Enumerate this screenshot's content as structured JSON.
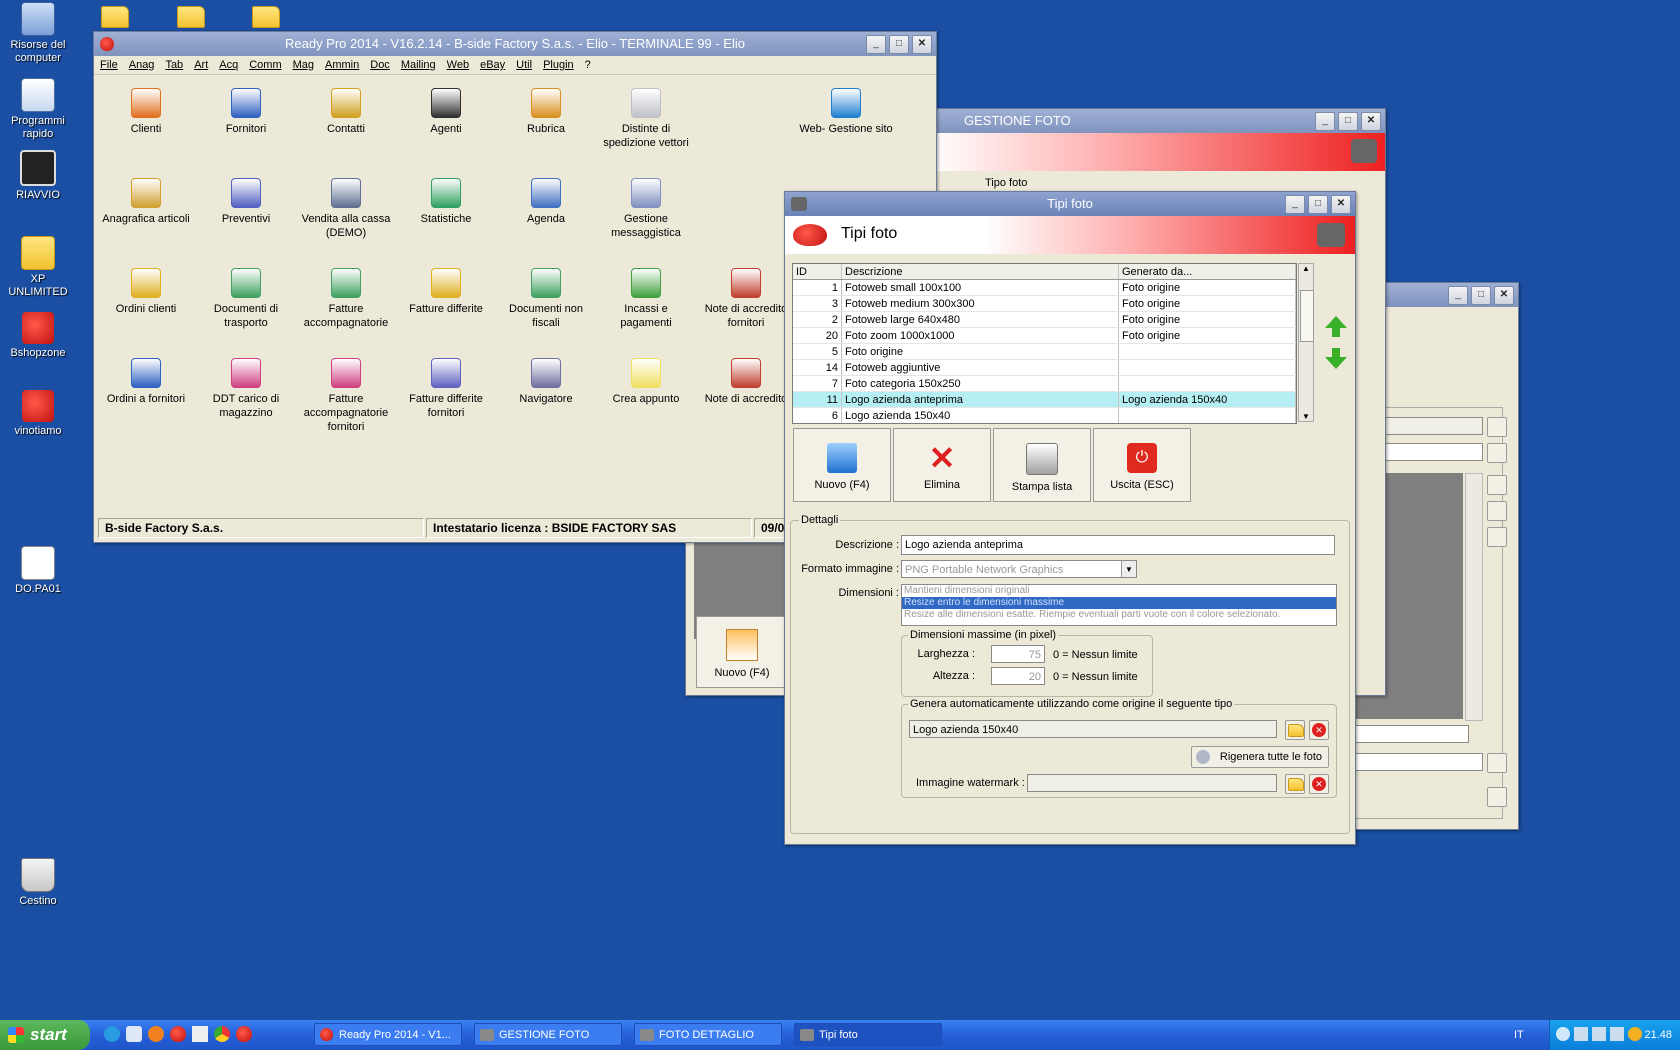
{
  "desktop": {
    "icons": [
      {
        "label": "Risorse del computer"
      },
      {
        "label": "Programmi rapido"
      },
      {
        "label": "RIAVVIO"
      },
      {
        "label": "XP UNLIMITED"
      },
      {
        "label": "Bshopzone"
      },
      {
        "label": "vinotiamo"
      },
      {
        "label": "DO.PA01"
      },
      {
        "label": "Cestino"
      }
    ]
  },
  "main_window": {
    "title": "Ready Pro 2014 - V16.2.14 - B-side Factory S.a.s. - Elio - TERMINALE 99 - Elio",
    "menu": [
      "File",
      "Anag",
      "Tab",
      "Art",
      "Acq",
      "Comm",
      "Mag",
      "Ammin",
      "Doc",
      "Mailing",
      "Web",
      "eBay",
      "Util",
      "Plugin",
      "?"
    ],
    "icons": [
      {
        "label": "Clienti",
        "color": "#e07020"
      },
      {
        "label": "Fornitori",
        "color": "#3060c0"
      },
      {
        "label": "Contatti",
        "color": "#d0a020"
      },
      {
        "label": "Agenti",
        "color": "#303030"
      },
      {
        "label": "Rubrica",
        "color": "#d89020"
      },
      {
        "label": "Distinte di spedizione vettori",
        "color": "#c0c0c8"
      },
      {
        "label": "Web- Gestione sito",
        "color": "#2080d0"
      },
      {
        "label": "Anagrafica articoli",
        "color": "#d0a030"
      },
      {
        "label": "Preventivi",
        "color": "#5060c0"
      },
      {
        "label": "Vendita alla cassa (DEMO)",
        "color": "#607090"
      },
      {
        "label": "Statistiche",
        "color": "#30a060"
      },
      {
        "label": "Agenda",
        "color": "#4070c0"
      },
      {
        "label": "Gestione messaggistica",
        "color": "#8090c0"
      },
      {
        "label": "Ordini clienti",
        "color": "#e0b020"
      },
      {
        "label": "Documenti di trasporto",
        "color": "#40a060"
      },
      {
        "label": "Fatture accompagnatorie",
        "color": "#40a060"
      },
      {
        "label": "Fatture differite",
        "color": "#e0b020"
      },
      {
        "label": "Documenti non fiscali",
        "color": "#40a060"
      },
      {
        "label": "Incassi e pagamenti",
        "color": "#40a040"
      },
      {
        "label": "Note di accredito fornitori",
        "color": "#c04030"
      },
      {
        "label": "Ordini a fornitori",
        "color": "#3060c0"
      },
      {
        "label": "DDT carico di magazzino",
        "color": "#d04080"
      },
      {
        "label": "Fatture accompagnatorie fornitori",
        "color": "#d04080"
      },
      {
        "label": "Fatture differite fornitori",
        "color": "#6060c0"
      },
      {
        "label": "Navigatore",
        "color": "#7070a0"
      },
      {
        "label": "Crea appunto",
        "color": "#f0e060"
      },
      {
        "label": "Note di accredito",
        "color": "#c04030"
      }
    ],
    "status": {
      "company": "B-side Factory S.a.s.",
      "license": "Intestatario licenza : BSIDE FACTORY SAS",
      "date": "09/0"
    }
  },
  "gestione_foto_window": {
    "title": "GESTIONE FOTO",
    "tab_label": "Tipo foto",
    "new_button": "Nuovo (F4)"
  },
  "tipi_foto_window": {
    "title": "Tipi foto",
    "header": "Tipi foto",
    "table": {
      "columns": [
        "ID",
        "Descrizione",
        "Generato da..."
      ],
      "rows": [
        {
          "id": "1",
          "desc": "Fotoweb small 100x100",
          "gen": "Foto origine"
        },
        {
          "id": "3",
          "desc": "Fotoweb medium 300x300",
          "gen": "Foto origine"
        },
        {
          "id": "2",
          "desc": "Fotoweb large 640x480",
          "gen": "Foto origine"
        },
        {
          "id": "20",
          "desc": "Foto zoom 1000x1000",
          "gen": "Foto origine"
        },
        {
          "id": "5",
          "desc": "Foto origine",
          "gen": ""
        },
        {
          "id": "14",
          "desc": "Fotoweb aggiuntive",
          "gen": ""
        },
        {
          "id": "7",
          "desc": "Foto categoria 150x250",
          "gen": ""
        },
        {
          "id": "11",
          "desc": "Logo azienda anteprima",
          "gen": "Logo azienda 150x40"
        },
        {
          "id": "6",
          "desc": "Logo azienda 150x40",
          "gen": ""
        }
      ],
      "selected_index": 7
    },
    "buttons": {
      "new": "Nuovo (F4)",
      "delete": "Elimina",
      "print": "Stampa lista",
      "exit": "Uscita (ESC)"
    },
    "details": {
      "group_label": "Dettagli",
      "description_label": "Descrizione :",
      "description_value": "Logo azienda anteprima",
      "format_label": "Formato immagine :",
      "format_value": "PNG Portable Network Graphics",
      "dimensions_label": "Dimensioni :",
      "dimension_options": [
        "Mantieni dimensioni originali",
        "Resize entro le dimensioni massime",
        "Resize alle dimensioni esatte. Riempie eventuali parti vuote con il colore selezionato."
      ],
      "dimension_selected": 1,
      "max_group_label": "Dimensioni massime (in pixel)",
      "width_label": "Larghezza :",
      "width_value": "75",
      "height_label": "Altezza :",
      "height_value": "20",
      "no_limit_hint": "0 = Nessun limite",
      "auto_group_label": "Genera automaticamente utilizzando come origine il seguente tipo",
      "auto_source_value": "Logo azienda 150x40",
      "regen_button": "Rigenera tutte le foto",
      "watermark_label": "Immagine watermark :",
      "watermark_value": ""
    }
  },
  "taskbar": {
    "start": "start",
    "items": [
      {
        "label": "Ready Pro 2014 - V1..."
      },
      {
        "label": "GESTIONE FOTO"
      },
      {
        "label": "FOTO DETTAGLIO"
      },
      {
        "label": "Tipi foto"
      }
    ],
    "lang": "IT",
    "clock": "21.48"
  }
}
